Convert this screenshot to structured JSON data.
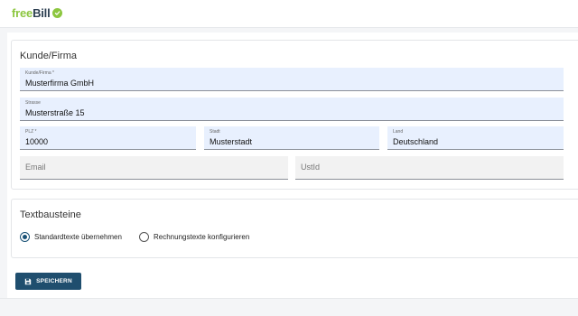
{
  "app": {
    "logo_free": "free",
    "logo_bill": "Bill"
  },
  "customer": {
    "title": "Kunde/Firma",
    "company": {
      "label": "Kunde/Firma *",
      "value": "Musterfirma GmbH"
    },
    "street": {
      "label": "Strasse",
      "value": "Musterstraße 15"
    },
    "zip": {
      "label": "PLZ *",
      "value": "10000"
    },
    "city": {
      "label": "Stadt",
      "value": "Musterstadt"
    },
    "country": {
      "label": "Land",
      "value": "Deutschland"
    },
    "email": {
      "placeholder": "Email",
      "value": ""
    },
    "vat": {
      "placeholder": "UstId",
      "value": ""
    }
  },
  "textblocks": {
    "title": "Textbausteine",
    "options": [
      {
        "label": "Standardtexte übernehmen",
        "checked": true
      },
      {
        "label": "Rechnungstexte konfigurieren",
        "checked": false
      }
    ]
  },
  "actions": {
    "save_label": "SPEICHERN"
  },
  "colors": {
    "accent": "#1f4e6e",
    "brand_green": "#8cc63f",
    "field_bg": "#e8f0fe"
  }
}
